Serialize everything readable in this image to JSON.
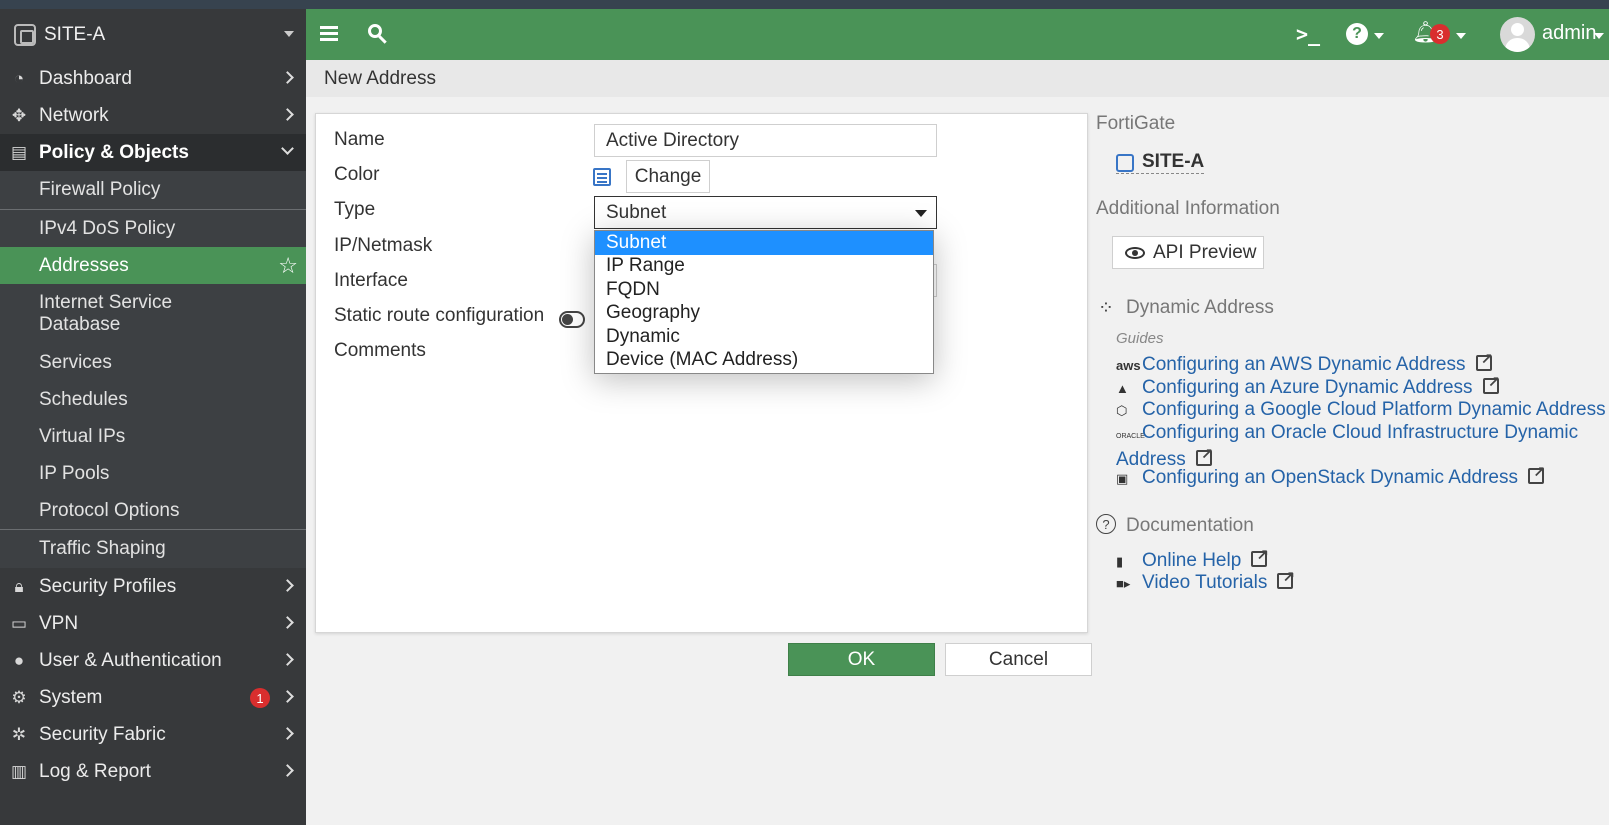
{
  "sidebar": {
    "site_name": "SITE-A",
    "items": [
      {
        "label": "Dashboard",
        "icon": "dashboard-icon"
      },
      {
        "label": "Network",
        "icon": "network-icon"
      },
      {
        "label": "Policy & Objects",
        "icon": "policy-icon"
      },
      {
        "label": "Security Profiles",
        "icon": "lock-icon"
      },
      {
        "label": "VPN",
        "icon": "laptop-icon"
      },
      {
        "label": "User & Authentication",
        "icon": "user-icon"
      },
      {
        "label": "System",
        "icon": "gear-icon",
        "badge": "1"
      },
      {
        "label": "Security Fabric",
        "icon": "fabric-icon"
      },
      {
        "label": "Log & Report",
        "icon": "chart-icon"
      }
    ],
    "policy_subitems": [
      "Firewall Policy",
      "IPv4 DoS Policy",
      "Addresses",
      "Internet Service Database",
      "Services",
      "Schedules",
      "Virtual IPs",
      "IP Pools",
      "Protocol Options",
      "Traffic Shaping"
    ]
  },
  "topbar": {
    "prompt_glyph": ">_",
    "help_glyph": "?",
    "notifications": "3",
    "user": "admin"
  },
  "breadcrumb": "New Address",
  "form": {
    "labels": {
      "name": "Name",
      "color": "Color",
      "type": "Type",
      "ipmask": "IP/Netmask",
      "interface": "Interface",
      "static_route": "Static route configuration",
      "comments": "Comments"
    },
    "name_value": "Active Directory",
    "change_label": "Change",
    "type_value": "Subnet",
    "type_options": [
      "Subnet",
      "IP Range",
      "FQDN",
      "Geography",
      "Dynamic",
      "Device (MAC Address)"
    ]
  },
  "right": {
    "fortigate_heading": "FortiGate",
    "site_link": "SITE-A",
    "additional_heading": "Additional Information",
    "api_preview": "API Preview",
    "dynamic_heading": "Dynamic Address",
    "guides_label": "Guides",
    "guides": [
      {
        "icon_text": "aws",
        "text": "Configuring an AWS Dynamic Address"
      },
      {
        "icon_text": "▲",
        "text": "Configuring an Azure Dynamic Address"
      },
      {
        "icon_text": "⬡",
        "text": "Configuring a Google Cloud Platform Dynamic Address"
      },
      {
        "icon_text": "ORACLE",
        "text_line1": "Configuring an Oracle Cloud Infrastructure Dynamic",
        "text_line2": "Address"
      },
      {
        "icon_text": "▣",
        "text": "Configuring an OpenStack Dynamic Address"
      }
    ],
    "documentation_heading": "Documentation",
    "docs": [
      {
        "icon": "book-icon",
        "text": "Online Help"
      },
      {
        "icon": "video-icon",
        "text": "Video Tutorials"
      }
    ]
  },
  "buttons": {
    "ok": "OK",
    "cancel": "Cancel"
  },
  "colors": {
    "brand_green": "#4a9357",
    "sidebar_bg": "#37393b",
    "link_blue": "#2563a8",
    "selected_blue": "#1e90ff",
    "badge_red": "#d92e2e"
  }
}
